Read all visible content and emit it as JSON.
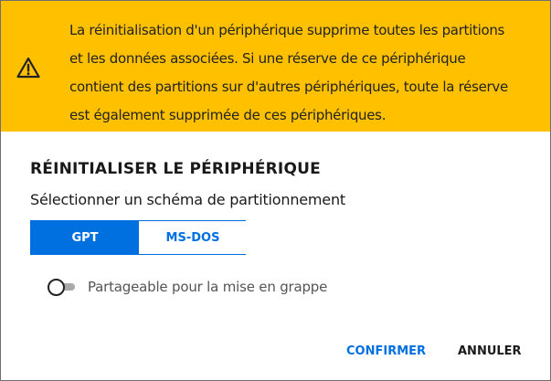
{
  "warning": {
    "icon": "warning-triangle-icon",
    "lines": [
      "La réinitialisation d'un périphérique supprime toutes les partitions",
      "et les données associées. Si une réserve de ce périphérique",
      "contient des partitions sur d'autres périphériques, toute la réserve",
      "est également supprimée de ces périphériques."
    ],
    "background": "#ffc000"
  },
  "dialog": {
    "title": "RÉINITIALISER LE PÉRIPHÉRIQUE",
    "scheme_label": "Sélectionner un schéma de partitionnement",
    "scheme_options": [
      "GPT",
      "MS-DOS"
    ],
    "selected_scheme": "GPT",
    "shareable": {
      "label": "Partageable pour la mise en grappe",
      "enabled": false
    },
    "confirm_label": "CONFIRMER",
    "cancel_label": "ANNULER",
    "accent_color": "#0070e0"
  }
}
